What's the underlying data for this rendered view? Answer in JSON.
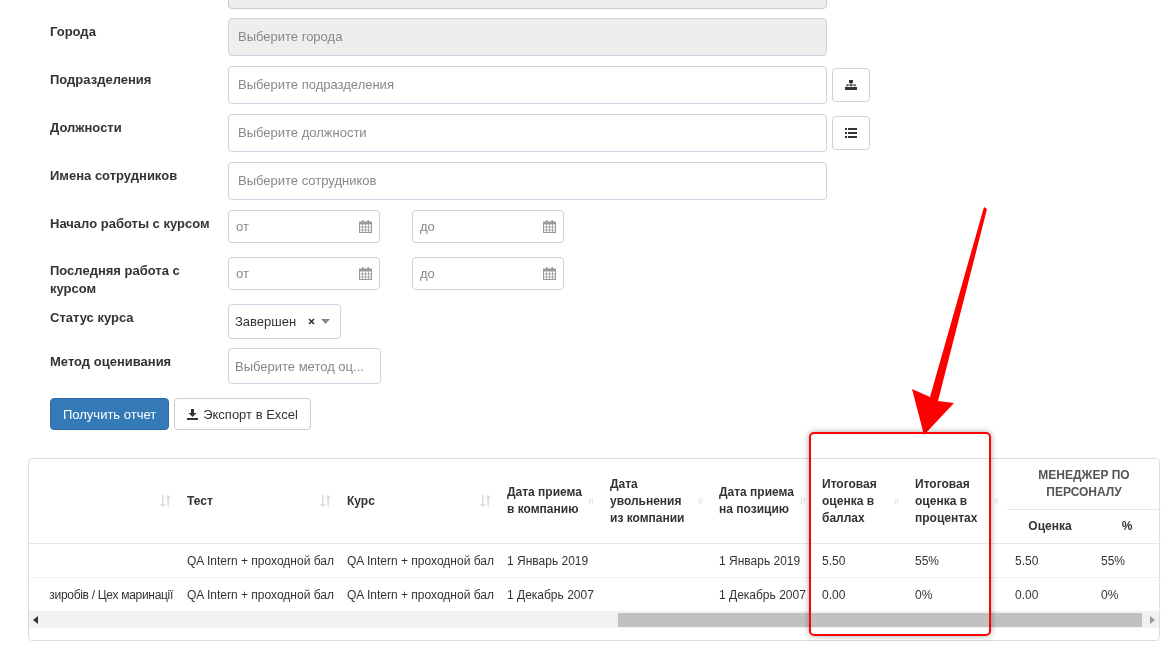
{
  "filters": [
    {
      "label": "Города",
      "kind": "select",
      "placeholder": "Выберите города",
      "disabled": true
    },
    {
      "label": "Подразделения",
      "kind": "select_tree",
      "placeholder": "Выберите подразделения",
      "disabled": false
    },
    {
      "label": "Должности",
      "kind": "select_list",
      "placeholder": "Выберите должности",
      "disabled": false
    },
    {
      "label": "Имена сотрудников",
      "kind": "select",
      "placeholder": "Выберите сотрудников",
      "disabled": false
    },
    {
      "label": "Начало работы с курсом",
      "kind": "date_range",
      "from_placeholder": "от",
      "to_placeholder": "до"
    },
    {
      "label": "Последняя работа с курсом",
      "kind": "date_range",
      "from_placeholder": "от",
      "to_placeholder": "до"
    },
    {
      "label": "Статус курса",
      "kind": "tag_select",
      "value": "Завершен"
    },
    {
      "label": "Метод оценивания",
      "kind": "dropdown",
      "placeholder": "Выберите метод оц..."
    }
  ],
  "buttons": [
    {
      "label": "Получить отчет",
      "kind": "primary"
    },
    {
      "label": "Экспорт в Excel",
      "kind": "export"
    }
  ],
  "table": {
    "columns": [
      {},
      {
        "label": "Тест"
      },
      {
        "label": "Курс"
      },
      {
        "label": "Дата приема в компанию"
      },
      {
        "label": "Дата увольнения из компании"
      },
      {
        "label": "Дата приема на позицию"
      },
      {
        "label": "Итоговая оценка в баллах"
      },
      {
        "label": "Итоговая оценка в процентах"
      }
    ],
    "group": {
      "label": "МЕНЕДЖЕР ПО ПЕРСОНАЛУ",
      "columns": [
        "Оценка",
        "%"
      ]
    },
    "rows": [
      [
        "",
        "QA Intern + проходной бал",
        "QA Intern + проходной бал",
        "1 Январь 2019",
        "",
        "1 Январь 2019",
        "5.50",
        "55%",
        "5.50",
        "55%"
      ],
      [
        "зиробів / Цех маринації",
        "QA Intern + проходной бал",
        "QA Intern + проходной бал",
        "1 Декабрь 2007",
        "",
        "1 Декабрь 2007",
        "0.00",
        "0%",
        "0.00",
        "0%"
      ]
    ]
  }
}
